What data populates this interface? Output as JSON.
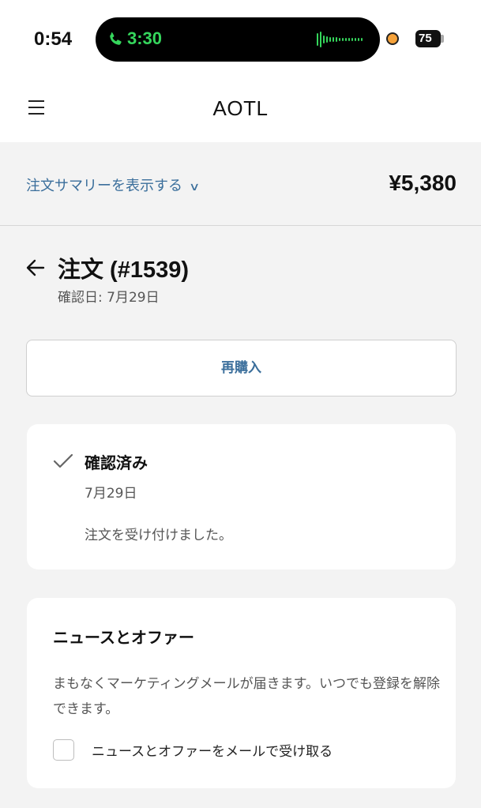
{
  "status_bar": {
    "time": "0:54",
    "call_timer": "3:30",
    "battery": "75"
  },
  "nav": {
    "brand": "AOTL"
  },
  "summary": {
    "toggle_label": "注文サマリーを表示する",
    "total": "¥5,380"
  },
  "order": {
    "title": "注文 (#1539)",
    "confirmed_date": "確認日: 7月29日",
    "rebuy_label": "再購入"
  },
  "status_card": {
    "title": "確認済み",
    "date": "7月29日",
    "message": "注文を受け付けました。"
  },
  "news_card": {
    "title": "ニュースとオファー",
    "description": "まもなくマーケティングメールが届きます。いつでも登録を解除できます。",
    "checkbox_label": "ニュースとオファーをメールで受け取る",
    "checkbox_checked": false
  },
  "colors": {
    "link_blue": "#3a6e9b",
    "call_green": "#35d65c",
    "indicator_orange": "#f5a23a",
    "page_bg": "#f3f3f3"
  },
  "icons": [
    "phone-icon",
    "audio-wave-icon",
    "hamburger-menu-icon",
    "chevron-down-icon",
    "back-arrow-icon",
    "checkmark-icon"
  ]
}
